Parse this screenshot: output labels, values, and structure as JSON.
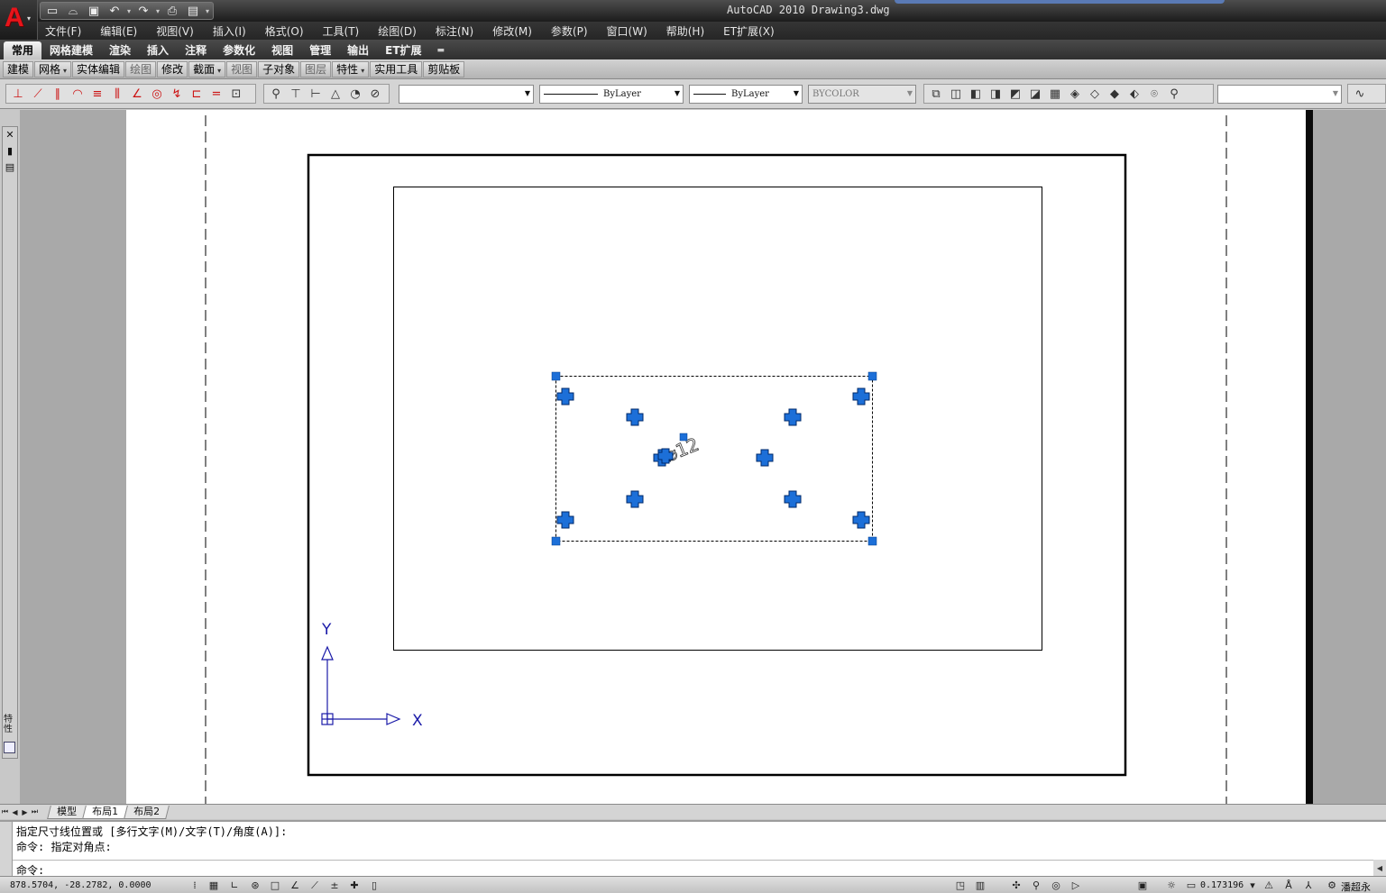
{
  "app": {
    "logo_letter": "A",
    "title": "AutoCAD 2010  Drawing3.dwg"
  },
  "quick_access": [
    {
      "name": "new-icon",
      "glyph": "🗋"
    },
    {
      "name": "open-icon",
      "glyph": "🗁"
    },
    {
      "name": "save-icon",
      "glyph": "💾"
    },
    {
      "name": "undo-icon",
      "glyph": "↶"
    },
    {
      "name": "redo-icon",
      "glyph": "↷"
    },
    {
      "name": "plot-icon",
      "glyph": "⎙"
    },
    {
      "name": "publish-icon",
      "glyph": "▤"
    }
  ],
  "menu": [
    "文件(F)",
    "编辑(E)",
    "视图(V)",
    "插入(I)",
    "格式(O)",
    "工具(T)",
    "绘图(D)",
    "标注(N)",
    "修改(M)",
    "参数(P)",
    "窗口(W)",
    "帮助(H)",
    "ET扩展(X)"
  ],
  "ribbon_tabs": [
    "常用",
    "网格建模",
    "渲染",
    "插入",
    "注释",
    "参数化",
    "视图",
    "管理",
    "输出",
    "ET扩展"
  ],
  "ribbon_panels": [
    {
      "label": "建模",
      "arrow": false,
      "dim": false
    },
    {
      "label": "网格",
      "arrow": true,
      "dim": false
    },
    {
      "label": "实体编辑",
      "arrow": false,
      "dim": false
    },
    {
      "label": "绘图",
      "arrow": false,
      "dim": true
    },
    {
      "label": "修改",
      "arrow": false,
      "dim": false
    },
    {
      "label": "截面",
      "arrow": true,
      "dim": false
    },
    {
      "label": "视图",
      "arrow": false,
      "dim": true
    },
    {
      "label": "子对象",
      "arrow": false,
      "dim": false
    },
    {
      "label": "图层",
      "arrow": false,
      "dim": true
    },
    {
      "label": "特性",
      "arrow": true,
      "dim": false
    },
    {
      "label": "实用工具",
      "arrow": false,
      "dim": false
    },
    {
      "label": "剪贴板",
      "arrow": false,
      "dim": false
    }
  ],
  "toolbar": {
    "layer_combo": "",
    "linetype": "ByLayer",
    "lineweight": "ByLayer",
    "plotstyle": "BYCOLOR"
  },
  "drawing": {
    "dimension_text": "⌀12",
    "ucs_x": "X",
    "ucs_y": "Y"
  },
  "layout_tabs": [
    "模型",
    "布局1",
    "布局2"
  ],
  "command": {
    "line1": "指定尺寸线位置或 [多行文字(M)/文字(T)/角度(A)]:",
    "line2": "命令: 指定对角点:",
    "prompt": "命令:"
  },
  "status": {
    "coords": "878.5704, -28.2782, 0.0000",
    "scale": "0.173196",
    "user": "潘超永"
  },
  "colors": {
    "grip": "#1c6fd8",
    "ucs": "#1a1aa8",
    "background": "#a9a9a9"
  }
}
